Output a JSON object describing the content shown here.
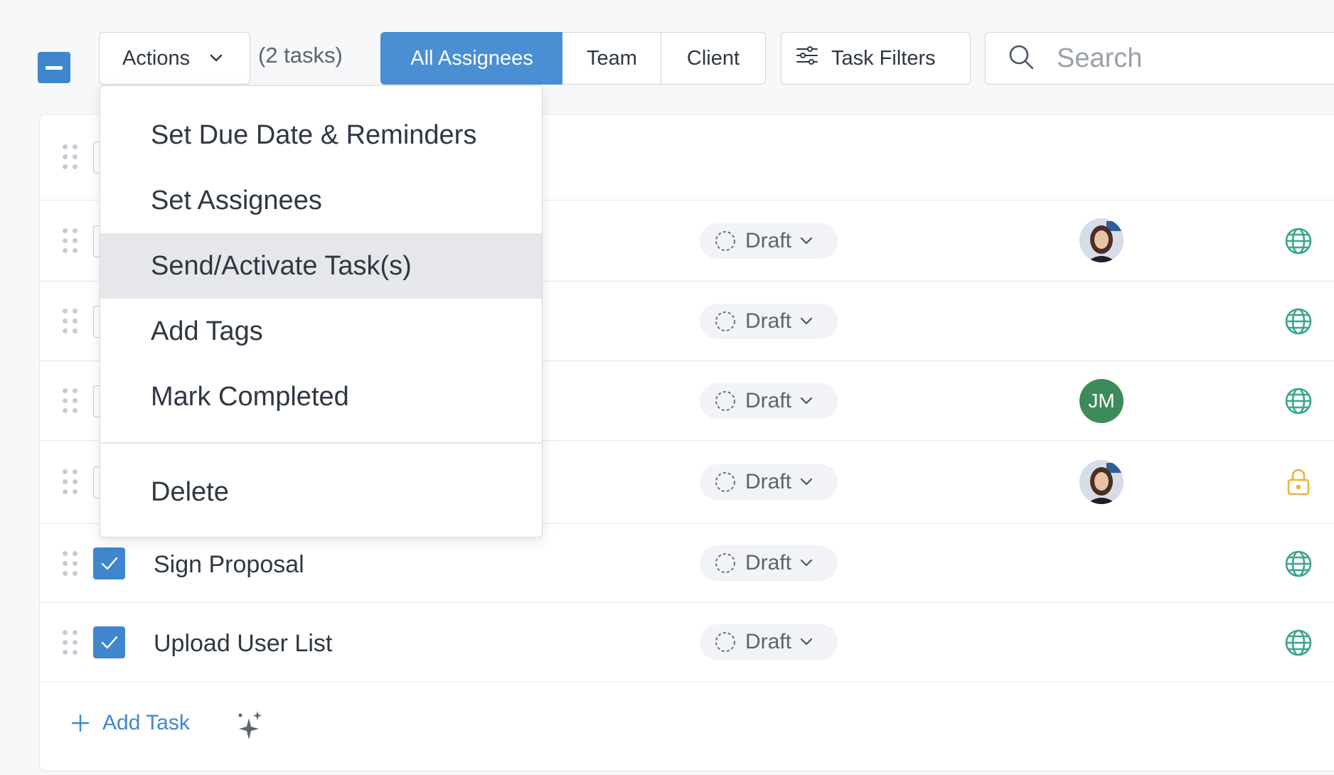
{
  "toolbar": {
    "actions_label": "Actions",
    "task_count": "(2 tasks)",
    "assignee_tabs": [
      "All Assignees",
      "Team",
      "Client"
    ],
    "active_tab": "All Assignees",
    "filters_label": "Task Filters",
    "search_placeholder": "Search"
  },
  "actions_menu": {
    "items": [
      "Set Due Date & Reminders",
      "Set Assignees",
      "Send/Activate Task(s)",
      "Add Tags",
      "Mark Completed"
    ],
    "danger_item": "Delete",
    "highlighted_item": "Send/Activate Task(s)"
  },
  "tasks": [
    {
      "name": "",
      "checked": false,
      "status": "",
      "assignee": "",
      "visibility": ""
    },
    {
      "name": "",
      "checked": false,
      "status": "Draft",
      "assignee": "photo",
      "visibility": "globe-icon"
    },
    {
      "name": "",
      "checked": false,
      "status": "Draft",
      "assignee": "",
      "visibility": "globe-icon"
    },
    {
      "name": "",
      "checked": false,
      "status": "Draft",
      "assignee": "JM",
      "visibility": "globe-icon"
    },
    {
      "name": "",
      "checked": false,
      "status": "Draft",
      "assignee": "photo",
      "visibility": "lock-icon"
    },
    {
      "name": "Sign Proposal",
      "checked": true,
      "status": "Draft",
      "assignee": "",
      "visibility": "globe-icon"
    },
    {
      "name": "Upload User List",
      "checked": true,
      "status": "Draft",
      "assignee": "",
      "visibility": "globe-icon"
    }
  ],
  "footer": {
    "add_task_label": "Add Task"
  },
  "colors": {
    "primary": "#3f86cf",
    "globe": "#3aa58c",
    "lock": "#e6b43a",
    "avatar_jm": "#3d8a5a"
  }
}
